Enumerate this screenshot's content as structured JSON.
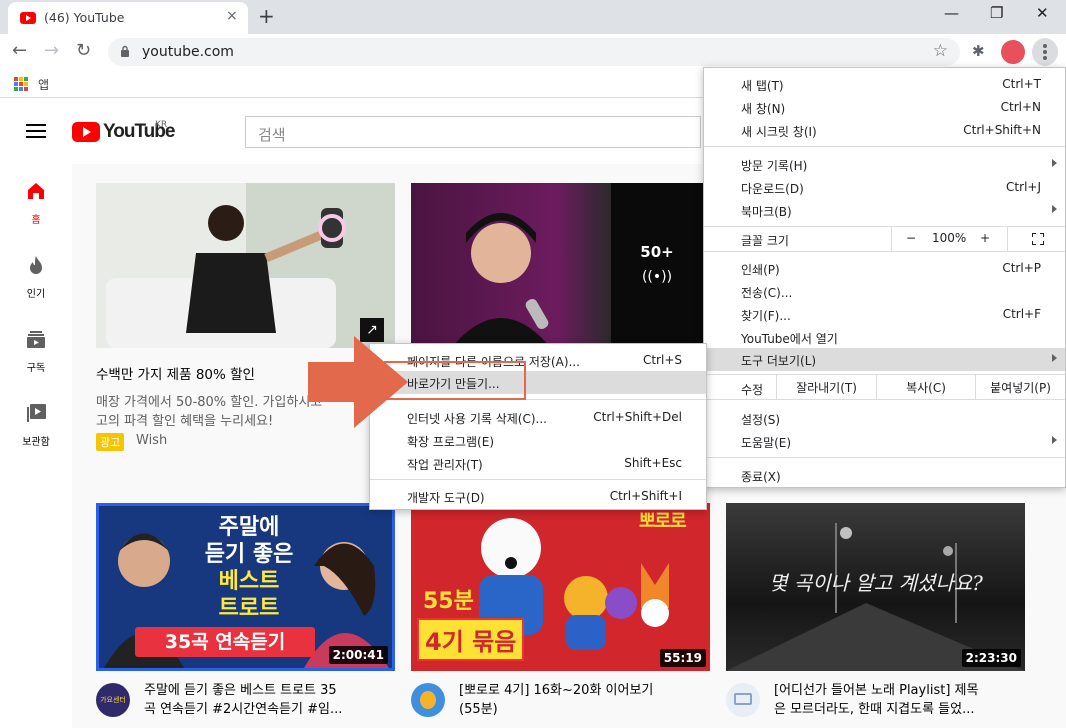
{
  "browser": {
    "tab_title": "(46) YouTube",
    "tab_close": "×",
    "new_tab": "+",
    "window_minimize": "—",
    "window_restore": "❐",
    "window_close": "✕",
    "url": "youtube.com",
    "apps_label": "앱"
  },
  "youtube": {
    "logo_text": "YouTube",
    "country_code": "KR",
    "search_placeholder": "검색",
    "guide": [
      {
        "label": "홈",
        "icon": "home-icon"
      },
      {
        "label": "인기",
        "icon": "flame-icon"
      },
      {
        "label": "구독",
        "icon": "subscriptions-icon"
      },
      {
        "label": "보관함",
        "icon": "library-icon"
      }
    ],
    "ad": {
      "title": "수백만 가지 제품 80% 할인",
      "desc_line1": "매장 가격에서 50-80% 할인. 가입하시고",
      "desc_line2": "고의 파격 할인 혜택을 누리세요!",
      "badge": "광고",
      "advertiser": "Wish"
    },
    "live_count": "50+",
    "videos": [
      {
        "thumb_line1": "주말에",
        "thumb_line2": "듣기 좋은",
        "thumb_line3": "베스트",
        "thumb_line4": "트로트",
        "thumb_line5": "35곡 연속듣기",
        "duration": "2:00:41",
        "title_line1": "주말에 듣기 좋은 베스트 트로트 35",
        "title_line2": "곡 연속듣기 #2시간연속듣기 #임...",
        "channel_badge": "가요센터"
      },
      {
        "thumb_brand": "뽀로로",
        "thumb_line1": "55분",
        "thumb_line2": "4기 묶음",
        "duration": "55:19",
        "title_line1": "[뽀로로 4기] 16화~20화 이어보기",
        "title_line2": "(55분)"
      },
      {
        "thumb_text": "몇 곡이나 알고 계셨나요?",
        "duration": "2:23:30",
        "title_line1": "[어디선가 들어본 노래 Playlist] 제목",
        "title_line2": "은 모르더라도, 한때 지겹도록 들었..."
      }
    ]
  },
  "menu": {
    "items": [
      {
        "label": "새 탭(T)",
        "shortcut": "Ctrl+T"
      },
      {
        "label": "새 창(N)",
        "shortcut": "Ctrl+N"
      },
      {
        "label": "새 시크릿 창(I)",
        "shortcut": "Ctrl+Shift+N"
      },
      {
        "label": "방문 기록(H)",
        "shortcut": ""
      },
      {
        "label": "다운로드(D)",
        "shortcut": "Ctrl+J"
      },
      {
        "label": "북마크(B)",
        "shortcut": ""
      },
      {
        "label": "인쇄(P)",
        "shortcut": "Ctrl+P"
      },
      {
        "label": "전송(C)...",
        "shortcut": ""
      },
      {
        "label": "찾기(F)...",
        "shortcut": "Ctrl+F"
      },
      {
        "label": "YouTube에서 열기",
        "shortcut": ""
      },
      {
        "label": "도구 더보기(L)",
        "shortcut": ""
      },
      {
        "label": "설정(S)",
        "shortcut": ""
      },
      {
        "label": "도움말(E)",
        "shortcut": ""
      },
      {
        "label": "종료(X)",
        "shortcut": ""
      }
    ],
    "zoom": {
      "label": "글꼴 크기",
      "minus": "−",
      "value": "100%",
      "plus": "+"
    },
    "edit": {
      "label": "수정",
      "cut": "잘라내기(T)",
      "copy": "복사(C)",
      "paste": "붙여넣기(P)"
    }
  },
  "submenu": {
    "items": [
      {
        "label": "페이지를 다른 이름으로 저장(A)...",
        "shortcut": "Ctrl+S"
      },
      {
        "label": "바로가기 만들기...",
        "shortcut": ""
      },
      {
        "label": "인터넷 사용 기록 삭제(C)...",
        "shortcut": "Ctrl+Shift+Del"
      },
      {
        "label": "확장 프로그램(E)",
        "shortcut": ""
      },
      {
        "label": "작업 관리자(T)",
        "shortcut": "Shift+Esc"
      },
      {
        "label": "개발자 도구(D)",
        "shortcut": "Ctrl+Shift+I"
      }
    ]
  },
  "colors": {
    "youtube_red": "#ff0000",
    "menu_highlight": "#dcdcdc",
    "annotation": "#e2694b"
  }
}
